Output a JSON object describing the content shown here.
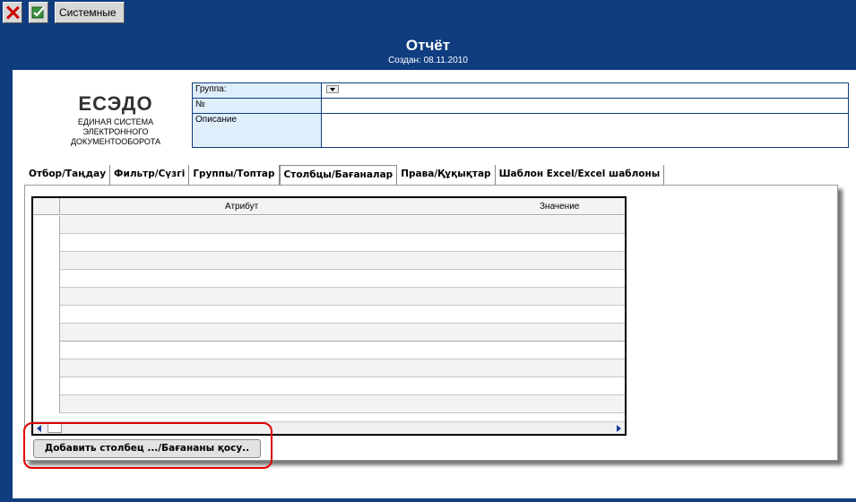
{
  "toolbar": {
    "close_icon": "close-icon",
    "confirm_icon": "checkmark-icon",
    "system_label": "Системные"
  },
  "header": {
    "title": "Отчёт",
    "subtitle": "Создан: 08.11.2010"
  },
  "logo": {
    "main": "ЕСЭДО",
    "line1": "ЕДИНАЯ СИСТЕМА",
    "line2": "ЭЛЕКТРОННОГО",
    "line3": "ДОКУМЕНТООБОРОТА"
  },
  "form": {
    "group_label": "Группа:",
    "group_value": "",
    "number_label": "№",
    "number_value": "",
    "description_label": "Описание",
    "description_value": ""
  },
  "tabs": [
    {
      "label": "Отбор/Таңдау"
    },
    {
      "label": "Фильтр/Сүзгі"
    },
    {
      "label": "Группы/Топтар"
    },
    {
      "label": "Столбцы/Бағаналар"
    },
    {
      "label": "Права/Құқықтар"
    },
    {
      "label": "Шаблон Excel/Excel шаблоны"
    }
  ],
  "active_tab": "Столбцы/Бағаналар",
  "grid": {
    "columns": [
      "Атрибут",
      "Значение"
    ],
    "row_count": 11
  },
  "add_column_button": "Добавить столбец .../Бағананы қосу..",
  "colors": {
    "frame": "#0f3d7f",
    "label_bg": "#dfeefb",
    "highlight": "#e00000"
  }
}
